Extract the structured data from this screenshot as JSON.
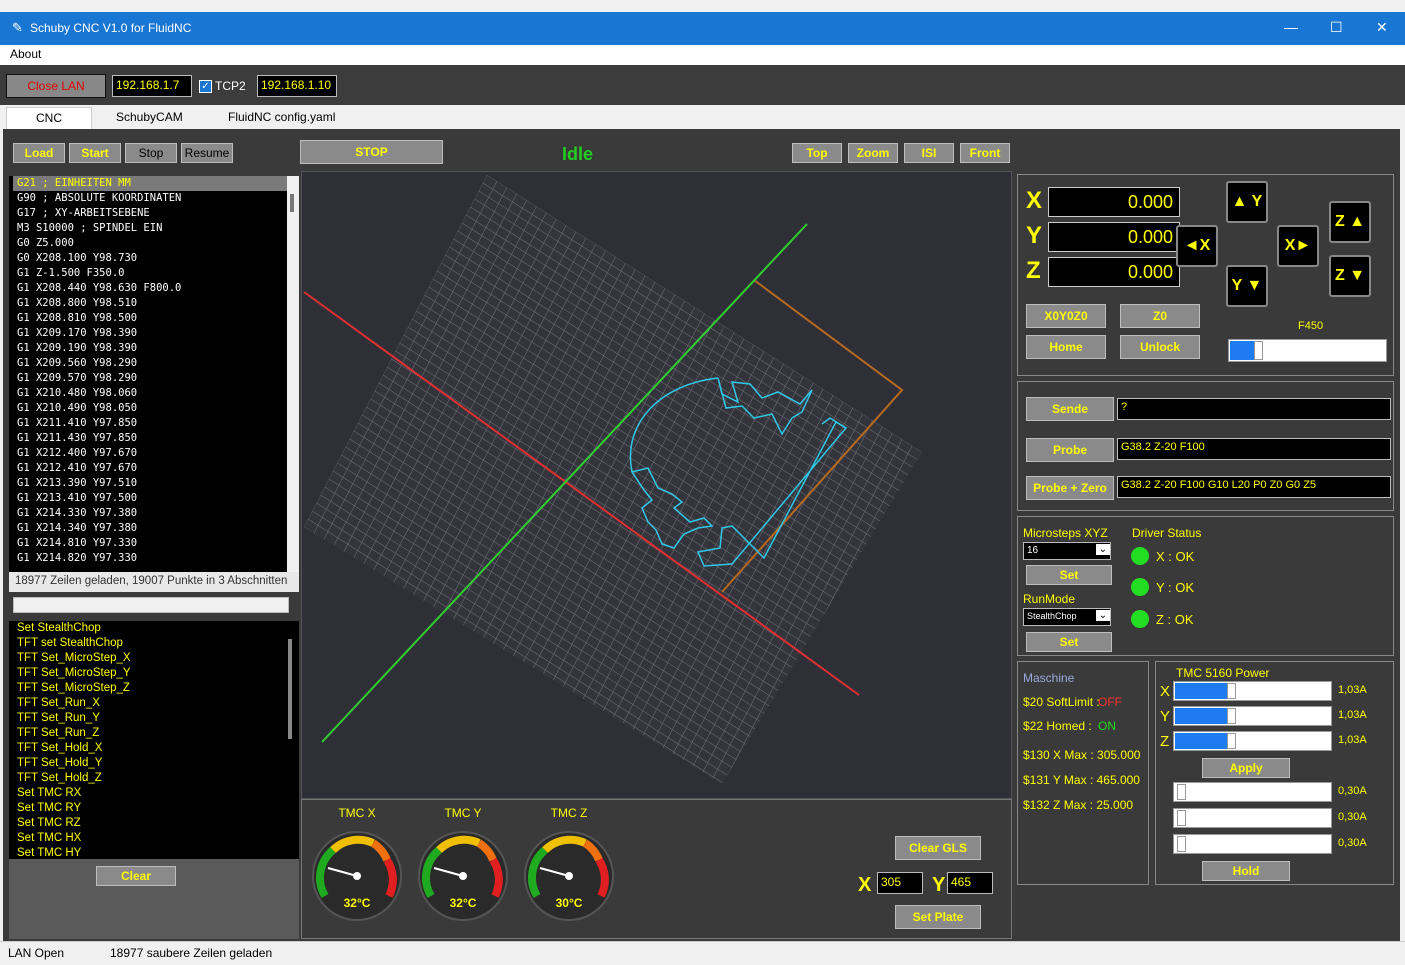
{
  "window": {
    "title": "Schuby CNC  V1.0 for FluidNC",
    "minimize": "—",
    "maximize": "☐",
    "close": "✕"
  },
  "menu": {
    "about": "About"
  },
  "toolbar": {
    "close_lan": "Close LAN",
    "ip1": "192.168.1.7",
    "tcp2_label": "TCP2",
    "tcp2_checked": true,
    "ip2": "192.168.1.10"
  },
  "tabs": [
    "CNC",
    "SchubyCAM",
    "FluidNC config.yaml"
  ],
  "controls": {
    "load": "Load",
    "start": "Start",
    "stop": "Stop",
    "resume": "Resume",
    "stop_big": "STOP",
    "state": "Idle",
    "view_top": "Top",
    "view_zoom": "Zoom",
    "view_isi": "ISI",
    "view_front": "Front"
  },
  "gcode": [
    "G21 ; EINHEITEN MM",
    "G90 ; ABSOLUTE KOORDINATEN",
    "G17 ; XY-ARBEITSEBENE",
    "M3 S10000 ; SPINDEL EIN",
    "G0 Z5.000",
    "G0 X208.100 Y98.730",
    "G1 Z-1.500 F350.0",
    "G1 X208.440 Y98.630 F800.0",
    "G1 X208.800 Y98.510",
    "G1 X208.810 Y98.500",
    "G1 X209.170 Y98.390",
    "G1 X209.190 Y98.390",
    "G1 X209.560 Y98.290",
    "G1 X209.570 Y98.290",
    "G1 X210.480 Y98.060",
    "G1 X210.490 Y98.050",
    "G1 X211.410 Y97.850",
    "G1 X211.430 Y97.850",
    "G1 X212.400 Y97.670",
    "G1 X212.410 Y97.670",
    "G1 X213.390 Y97.510",
    "G1 X213.410 Y97.500",
    "G1 X214.330 Y97.380",
    "G1 X214.340 Y97.380",
    "G1 X214.810 Y97.330",
    "G1 X214.820 Y97.330"
  ],
  "load_info": "18977 Zeilen geladen, 19007 Punkte in 3 Abschnitten",
  "log": [
    "Set StealthChop",
    "TFT set StealthChop",
    "TFT Set_MicroStep_X",
    "TFT Set_MicroStep_Y",
    "TFT Set_MicroStep_Z",
    "TFT Set_Run_X",
    "TFT Set_Run_Y",
    "TFT Set_Run_Z",
    "TFT Set_Hold_X",
    "TFT Set_Hold_Y",
    "TFT Set_Hold_Z",
    "Set TMC RX",
    "Set TMC RY",
    "Set TMC RZ",
    "Set TMC HX",
    "Set TMC HY"
  ],
  "clear": "Clear",
  "dro": {
    "x_label": "X",
    "y_label": "Y",
    "z_label": "Z",
    "x": "0.000",
    "y": "0.000",
    "z": "0.000"
  },
  "jog": {
    "y_plus": "▲ Y",
    "y_minus": "Y ▼",
    "x_minus": "◄X",
    "x_plus": "X►",
    "z_plus": "Z ▲",
    "z_minus": "Z ▼"
  },
  "zero": {
    "xyz": "X0Y0Z0",
    "z": "Z0",
    "home": "Home",
    "unlock": "Unlock"
  },
  "feed": {
    "label": "F450",
    "fraction": 0.16
  },
  "console": {
    "send": "Sende",
    "send_value": "?",
    "probe": "Probe",
    "probe_value": "G38.2 Z-20 F100",
    "probe_zero": "Probe + Zero",
    "probe_zero_value": "G38.2 Z-20 F100   G10 L20 P0 Z0 G0 Z5"
  },
  "driver": {
    "microsteps_label": "Microsteps XYZ",
    "microsteps_value": "16",
    "set": "Set",
    "runmode_label": "RunMode",
    "runmode_value": "StealthChop",
    "status_label": "Driver Status",
    "x_status": "X : OK",
    "y_status": "Y : OK",
    "z_status": "Z : OK"
  },
  "machine": {
    "title": "Maschine",
    "softlimit_label": "$20 SoftLimit :",
    "softlimit_value": "OFF",
    "homed_label": "$22 Homed :",
    "homed_value": "ON",
    "xmax": "$130  X Max :  305.000",
    "ymax": "$131  Y Max :  465.000",
    "zmax": "$132  Z Max :  25.000"
  },
  "tmc_power": {
    "title": "TMC 5160 Power",
    "run": [
      {
        "axis": "X",
        "value": "1,03A",
        "fraction": 0.34
      },
      {
        "axis": "Y",
        "value": "1,03A",
        "fraction": 0.34
      },
      {
        "axis": "Z",
        "value": "1,03A",
        "fraction": 0.34
      }
    ],
    "apply": "Apply",
    "hold": [
      {
        "value": "0,30A",
        "fraction": 0.02
      },
      {
        "value": "0,30A",
        "fraction": 0.02
      },
      {
        "value": "0,30A",
        "fraction": 0.02
      }
    ],
    "hold_btn": "Hold"
  },
  "temps": [
    {
      "label": "TMC X",
      "value": "32°C"
    },
    {
      "label": "TMC Y",
      "value": "32°C"
    },
    {
      "label": "TMC Z",
      "value": "30°C"
    }
  ],
  "plate": {
    "clear_gls": "Clear GLS",
    "x_label": "X",
    "x_value": "305",
    "y_label": "Y",
    "y_value": "465",
    "set_plate": "Set Plate"
  },
  "status": {
    "left": "LAN Open",
    "right": "18977 saubere Zeilen geladen"
  },
  "colors": {
    "accent_yellow": "#ffff00",
    "bg_panel": "#3a3a3a",
    "idle_green": "#22cc22",
    "titlebar_blue": "#1976d2"
  }
}
